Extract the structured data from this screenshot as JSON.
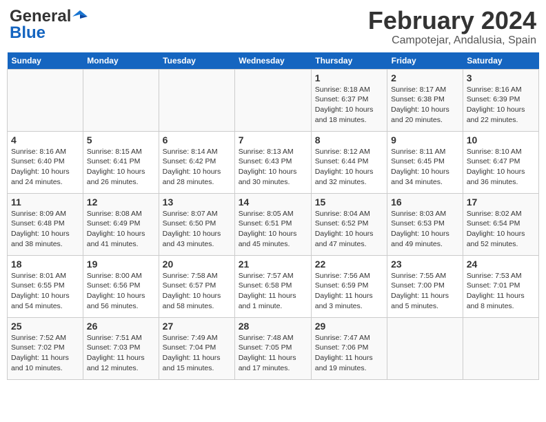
{
  "logo": {
    "line1": "General",
    "line2": "Blue"
  },
  "title": "February 2024",
  "location": "Campotejar, Andalusia, Spain",
  "days_of_week": [
    "Sunday",
    "Monday",
    "Tuesday",
    "Wednesday",
    "Thursday",
    "Friday",
    "Saturday"
  ],
  "weeks": [
    [
      {
        "day": "",
        "info": ""
      },
      {
        "day": "",
        "info": ""
      },
      {
        "day": "",
        "info": ""
      },
      {
        "day": "",
        "info": ""
      },
      {
        "day": "1",
        "info": "Sunrise: 8:18 AM\nSunset: 6:37 PM\nDaylight: 10 hours\nand 18 minutes."
      },
      {
        "day": "2",
        "info": "Sunrise: 8:17 AM\nSunset: 6:38 PM\nDaylight: 10 hours\nand 20 minutes."
      },
      {
        "day": "3",
        "info": "Sunrise: 8:16 AM\nSunset: 6:39 PM\nDaylight: 10 hours\nand 22 minutes."
      }
    ],
    [
      {
        "day": "4",
        "info": "Sunrise: 8:16 AM\nSunset: 6:40 PM\nDaylight: 10 hours\nand 24 minutes."
      },
      {
        "day": "5",
        "info": "Sunrise: 8:15 AM\nSunset: 6:41 PM\nDaylight: 10 hours\nand 26 minutes."
      },
      {
        "day": "6",
        "info": "Sunrise: 8:14 AM\nSunset: 6:42 PM\nDaylight: 10 hours\nand 28 minutes."
      },
      {
        "day": "7",
        "info": "Sunrise: 8:13 AM\nSunset: 6:43 PM\nDaylight: 10 hours\nand 30 minutes."
      },
      {
        "day": "8",
        "info": "Sunrise: 8:12 AM\nSunset: 6:44 PM\nDaylight: 10 hours\nand 32 minutes."
      },
      {
        "day": "9",
        "info": "Sunrise: 8:11 AM\nSunset: 6:45 PM\nDaylight: 10 hours\nand 34 minutes."
      },
      {
        "day": "10",
        "info": "Sunrise: 8:10 AM\nSunset: 6:47 PM\nDaylight: 10 hours\nand 36 minutes."
      }
    ],
    [
      {
        "day": "11",
        "info": "Sunrise: 8:09 AM\nSunset: 6:48 PM\nDaylight: 10 hours\nand 38 minutes."
      },
      {
        "day": "12",
        "info": "Sunrise: 8:08 AM\nSunset: 6:49 PM\nDaylight: 10 hours\nand 41 minutes."
      },
      {
        "day": "13",
        "info": "Sunrise: 8:07 AM\nSunset: 6:50 PM\nDaylight: 10 hours\nand 43 minutes."
      },
      {
        "day": "14",
        "info": "Sunrise: 8:05 AM\nSunset: 6:51 PM\nDaylight: 10 hours\nand 45 minutes."
      },
      {
        "day": "15",
        "info": "Sunrise: 8:04 AM\nSunset: 6:52 PM\nDaylight: 10 hours\nand 47 minutes."
      },
      {
        "day": "16",
        "info": "Sunrise: 8:03 AM\nSunset: 6:53 PM\nDaylight: 10 hours\nand 49 minutes."
      },
      {
        "day": "17",
        "info": "Sunrise: 8:02 AM\nSunset: 6:54 PM\nDaylight: 10 hours\nand 52 minutes."
      }
    ],
    [
      {
        "day": "18",
        "info": "Sunrise: 8:01 AM\nSunset: 6:55 PM\nDaylight: 10 hours\nand 54 minutes."
      },
      {
        "day": "19",
        "info": "Sunrise: 8:00 AM\nSunset: 6:56 PM\nDaylight: 10 hours\nand 56 minutes."
      },
      {
        "day": "20",
        "info": "Sunrise: 7:58 AM\nSunset: 6:57 PM\nDaylight: 10 hours\nand 58 minutes."
      },
      {
        "day": "21",
        "info": "Sunrise: 7:57 AM\nSunset: 6:58 PM\nDaylight: 11 hours\nand 1 minute."
      },
      {
        "day": "22",
        "info": "Sunrise: 7:56 AM\nSunset: 6:59 PM\nDaylight: 11 hours\nand 3 minutes."
      },
      {
        "day": "23",
        "info": "Sunrise: 7:55 AM\nSunset: 7:00 PM\nDaylight: 11 hours\nand 5 minutes."
      },
      {
        "day": "24",
        "info": "Sunrise: 7:53 AM\nSunset: 7:01 PM\nDaylight: 11 hours\nand 8 minutes."
      }
    ],
    [
      {
        "day": "25",
        "info": "Sunrise: 7:52 AM\nSunset: 7:02 PM\nDaylight: 11 hours\nand 10 minutes."
      },
      {
        "day": "26",
        "info": "Sunrise: 7:51 AM\nSunset: 7:03 PM\nDaylight: 11 hours\nand 12 minutes."
      },
      {
        "day": "27",
        "info": "Sunrise: 7:49 AM\nSunset: 7:04 PM\nDaylight: 11 hours\nand 15 minutes."
      },
      {
        "day": "28",
        "info": "Sunrise: 7:48 AM\nSunset: 7:05 PM\nDaylight: 11 hours\nand 17 minutes."
      },
      {
        "day": "29",
        "info": "Sunrise: 7:47 AM\nSunset: 7:06 PM\nDaylight: 11 hours\nand 19 minutes."
      },
      {
        "day": "",
        "info": ""
      },
      {
        "day": "",
        "info": ""
      }
    ]
  ]
}
